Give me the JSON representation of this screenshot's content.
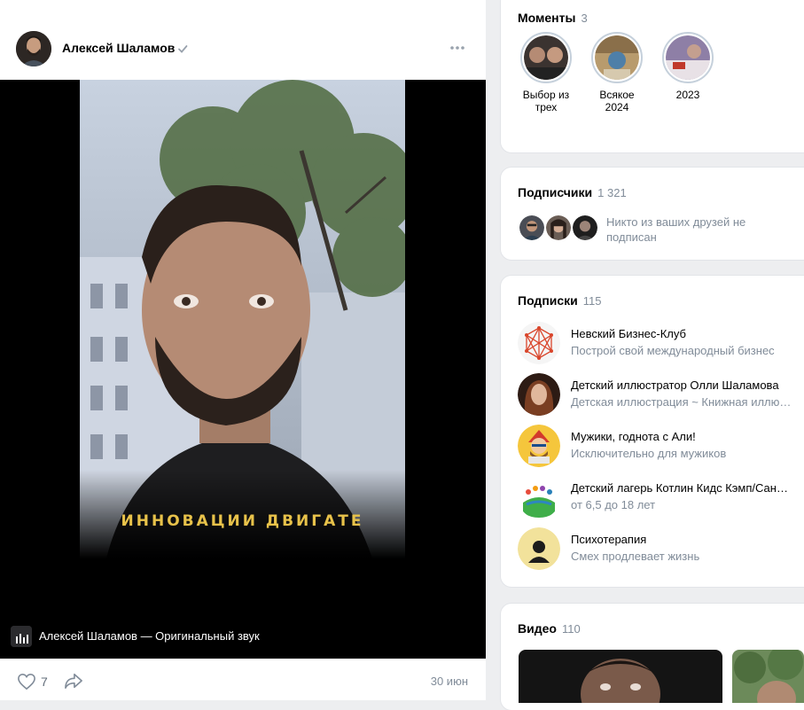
{
  "post": {
    "author_name": "Алексей Шаламов",
    "video_caption": "ИННОВАЦИИ ДВИГАТЕ",
    "sound_label": "Алексей Шаламов — Оригинальный звук",
    "likes": "7",
    "date": "30 июн"
  },
  "moments": {
    "title": "Моменты",
    "count": "3",
    "items": [
      {
        "label_line1": "Выбор из",
        "label_line2": "трех"
      },
      {
        "label_line1": "Всякое",
        "label_line2": "2024"
      },
      {
        "label_line1": "2023",
        "label_line2": ""
      }
    ]
  },
  "followers": {
    "title": "Подписчики",
    "count": "1 321",
    "note_line1": "Никто из ваших друзей не",
    "note_line2": "подписан"
  },
  "subscriptions": {
    "title": "Подписки",
    "count": "115",
    "items": [
      {
        "name": "Невский Бизнес-Клуб",
        "desc": "Построй свой международный бизнес"
      },
      {
        "name": "Детский иллюстратор Олли Шаламова",
        "desc": "Детская иллюстрация ~ Книжная иллюстрация"
      },
      {
        "name": "Мужики, годнота с Али!",
        "desc": "Исключительно для мужиков"
      },
      {
        "name": "Детский лагерь Котлин Кидс Кэмп/Санкт-Петербург",
        "desc": "от 6,5 до 18 лет"
      },
      {
        "name": "Психотерапия",
        "desc": "Смех продлевает жизнь"
      }
    ]
  },
  "videos": {
    "title": "Видео",
    "count": "110"
  },
  "colors": {
    "accent": "#2688eb",
    "muted": "#818c99",
    "caption": "#e8c24a",
    "page_bg": "#edeef0"
  }
}
